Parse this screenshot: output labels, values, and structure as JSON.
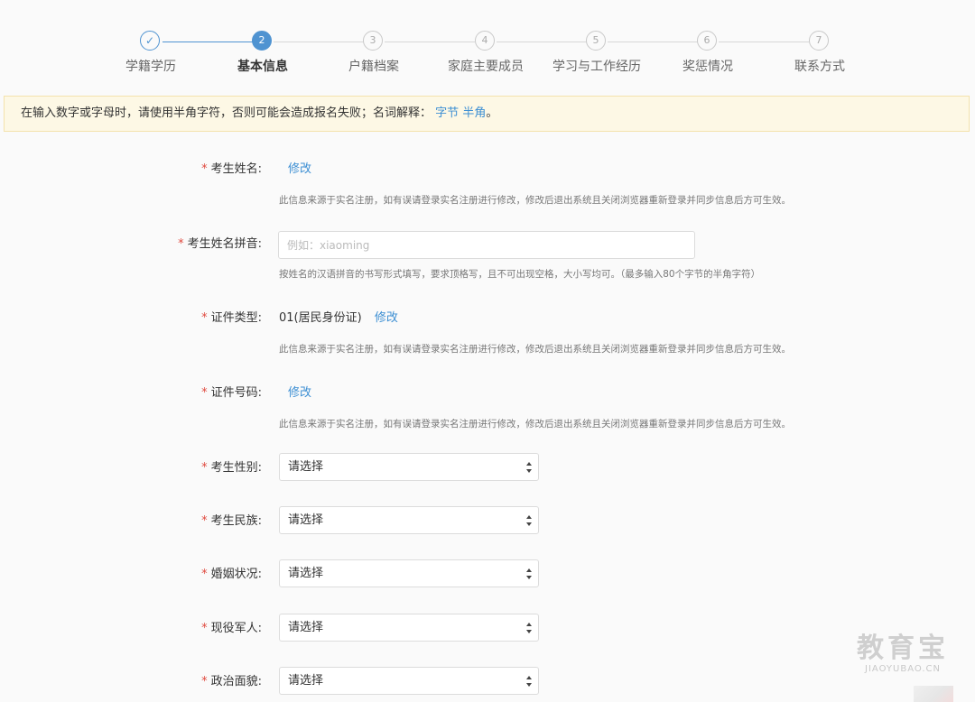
{
  "stepper": {
    "steps": [
      {
        "num": "✓",
        "label": "学籍学历"
      },
      {
        "num": "2",
        "label": "基本信息"
      },
      {
        "num": "3",
        "label": "户籍档案"
      },
      {
        "num": "4",
        "label": "家庭主要成员"
      },
      {
        "num": "5",
        "label": "学习与工作经历"
      },
      {
        "num": "6",
        "label": "奖惩情况"
      },
      {
        "num": "7",
        "label": "联系方式"
      }
    ]
  },
  "notice": {
    "text": "在输入数字或字母时，请使用半角字符，否则可能会造成报名失败；名词解释：",
    "link1": "字节",
    "link2": "半角",
    "end": "。"
  },
  "form": {
    "required_mark": "*",
    "name": {
      "label": "考生姓名:",
      "edit": "修改",
      "helper": "此信息来源于实名注册，如有误请登录实名注册进行修改，修改后退出系统且关闭浏览器重新登录并同步信息后方可生效。"
    },
    "pinyin": {
      "label": "考生姓名拼音:",
      "placeholder": "例如：xiaoming",
      "helper": "按姓名的汉语拼音的书写形式填写，要求顶格写，且不可出现空格，大小写均可。（最多输入80个字节的半角字符）"
    },
    "id_type": {
      "label": "证件类型:",
      "value": "01(居民身份证)",
      "edit": "修改",
      "helper": "此信息来源于实名注册，如有误请登录实名注册进行修改，修改后退出系统且关闭浏览器重新登录并同步信息后方可生效。"
    },
    "id_number": {
      "label": "证件号码:",
      "edit": "修改",
      "helper": "此信息来源于实名注册，如有误请登录实名注册进行修改，修改后退出系统且关闭浏览器重新登录并同步信息后方可生效。"
    },
    "gender": {
      "label": "考生性别:",
      "value": "请选择"
    },
    "ethnicity": {
      "label": "考生民族:",
      "value": "请选择"
    },
    "marital": {
      "label": "婚姻状况:",
      "value": "请选择"
    },
    "military": {
      "label": "现役军人:",
      "value": "请选择"
    },
    "political": {
      "label": "政治面貌:",
      "value": "请选择"
    }
  },
  "watermark": {
    "main": "教育宝",
    "sub": "JIAOYUBAO.CN"
  },
  "colors": {
    "accent": "#4f93d1",
    "link": "#3d8fd3",
    "required": "#e04a3f",
    "notice_bg": "#fdf8e5",
    "notice_border": "#f4e3ad"
  }
}
